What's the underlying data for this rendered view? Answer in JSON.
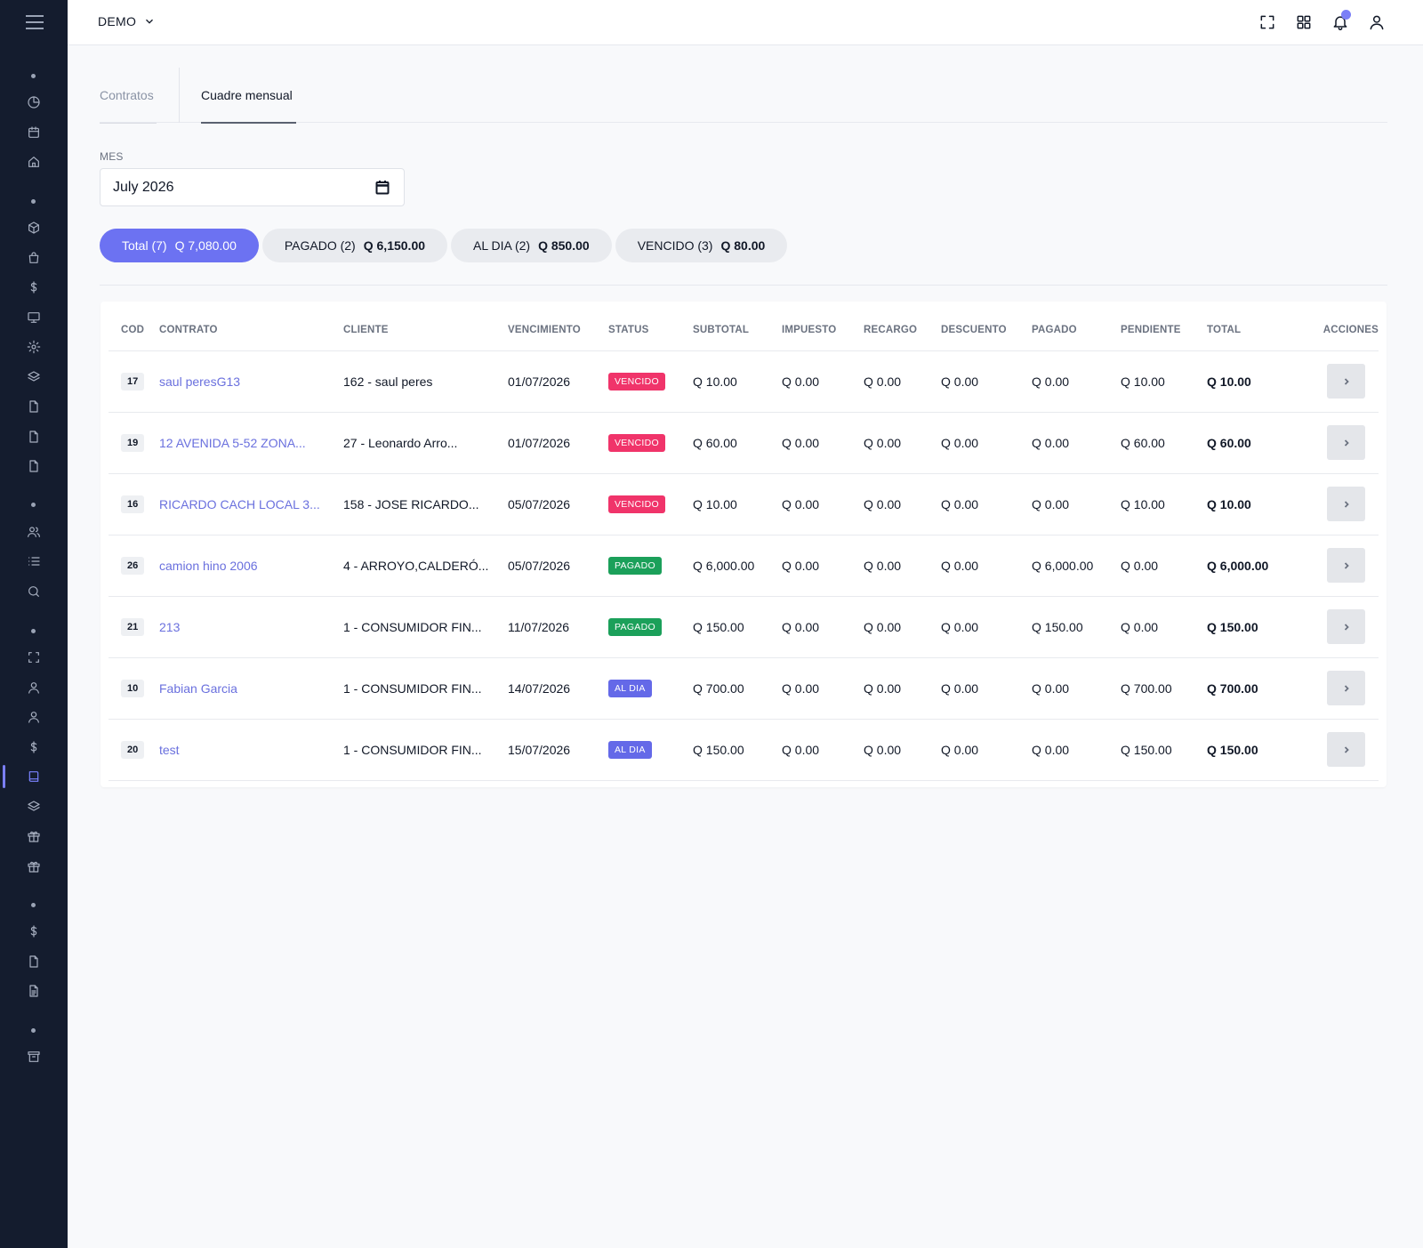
{
  "topbar": {
    "org_name": "DEMO"
  },
  "tabs": [
    {
      "label": "Contratos",
      "active": false
    },
    {
      "label": "Cuadre mensual",
      "active": true
    }
  ],
  "month_filter": {
    "label": "MES",
    "value": "July 2026"
  },
  "summary_filters": [
    {
      "label": "Total (7)",
      "amount": "Q 7,080.00",
      "active": true
    },
    {
      "label": "PAGADO (2)",
      "amount": "Q 6,150.00",
      "active": false
    },
    {
      "label": "AL DIA (2)",
      "amount": "Q 850.00",
      "active": false
    },
    {
      "label": "VENCIDO (3)",
      "amount": "Q 80.00",
      "active": false
    }
  ],
  "table": {
    "columns": [
      "COD",
      "CONTRATO",
      "CLIENTE",
      "VENCIMIENTO",
      "STATUS",
      "SUBTOTAL",
      "IMPUESTO",
      "RECARGO",
      "DESCUENTO",
      "PAGADO",
      "PENDIENTE",
      "TOTAL",
      "ACCIONES"
    ],
    "rows": [
      {
        "cod": "17",
        "contrato": "saul peresG13",
        "cliente": "162 - saul peres",
        "vencimiento": "01/07/2026",
        "status": "VENCIDO",
        "subtotal": "Q 10.00",
        "impuesto": "Q 0.00",
        "recargo": "Q 0.00",
        "descuento": "Q 0.00",
        "pagado": "Q 0.00",
        "pendiente": "Q 10.00",
        "total": "Q 10.00"
      },
      {
        "cod": "19",
        "contrato": "12 AVENIDA 5-52 ZONA...",
        "cliente": "27 - Leonardo Arro...",
        "vencimiento": "01/07/2026",
        "status": "VENCIDO",
        "subtotal": "Q 60.00",
        "impuesto": "Q 0.00",
        "recargo": "Q 0.00",
        "descuento": "Q 0.00",
        "pagado": "Q 0.00",
        "pendiente": "Q 60.00",
        "total": "Q 60.00"
      },
      {
        "cod": "16",
        "contrato": "RICARDO CACH LOCAL 3...",
        "cliente": "158 - JOSE RICARDO...",
        "vencimiento": "05/07/2026",
        "status": "VENCIDO",
        "subtotal": "Q 10.00",
        "impuesto": "Q 0.00",
        "recargo": "Q 0.00",
        "descuento": "Q 0.00",
        "pagado": "Q 0.00",
        "pendiente": "Q 10.00",
        "total": "Q 10.00"
      },
      {
        "cod": "26",
        "contrato": "camion hino 2006",
        "cliente": "4 - ARROYO,CALDERÓ...",
        "vencimiento": "05/07/2026",
        "status": "PAGADO",
        "subtotal": "Q 6,000.00",
        "impuesto": "Q 0.00",
        "recargo": "Q 0.00",
        "descuento": "Q 0.00",
        "pagado": "Q 6,000.00",
        "pendiente": "Q 0.00",
        "total": "Q 6,000.00"
      },
      {
        "cod": "21",
        "contrato": "213",
        "cliente": "1 - CONSUMIDOR FIN...",
        "vencimiento": "11/07/2026",
        "status": "PAGADO",
        "subtotal": "Q 150.00",
        "impuesto": "Q 0.00",
        "recargo": "Q 0.00",
        "descuento": "Q 0.00",
        "pagado": "Q 150.00",
        "pendiente": "Q 0.00",
        "total": "Q 150.00"
      },
      {
        "cod": "10",
        "contrato": "Fabian Garcia",
        "cliente": "1 - CONSUMIDOR FIN...",
        "vencimiento": "14/07/2026",
        "status": "AL DIA",
        "subtotal": "Q 700.00",
        "impuesto": "Q 0.00",
        "recargo": "Q 0.00",
        "descuento": "Q 0.00",
        "pagado": "Q 0.00",
        "pendiente": "Q 700.00",
        "total": "Q 700.00"
      },
      {
        "cod": "20",
        "contrato": "test",
        "cliente": "1 - CONSUMIDOR FIN...",
        "vencimiento": "15/07/2026",
        "status": "AL DIA",
        "subtotal": "Q 150.00",
        "impuesto": "Q 0.00",
        "recargo": "Q 0.00",
        "descuento": "Q 0.00",
        "pagado": "Q 0.00",
        "pendiente": "Q 150.00",
        "total": "Q 150.00"
      }
    ]
  },
  "colors": {
    "sidebar_bg": "#141c2e",
    "accent": "#6c72f2",
    "status_vencido": "#f0346a",
    "status_pagado": "#1ba05a",
    "status_aldia": "#6469e8"
  },
  "sidebar_icons": [
    "chart-pie-icon",
    "calendar-icon",
    "home-icon",
    "cube-icon",
    "shopping-bag-icon",
    "dollar-icon",
    "monitor-icon",
    "gear-icon",
    "layers-icon",
    "file-icon",
    "file-icon",
    "file-icon",
    "users-icon",
    "list-icon",
    "search-icon",
    "scan-icon",
    "user-icon",
    "user-icon",
    "dollar-icon",
    "book-icon",
    "layers-icon",
    "gift-icon",
    "gift-icon",
    "dollar-icon",
    "file-icon",
    "file-text-icon",
    "archive-icon"
  ]
}
